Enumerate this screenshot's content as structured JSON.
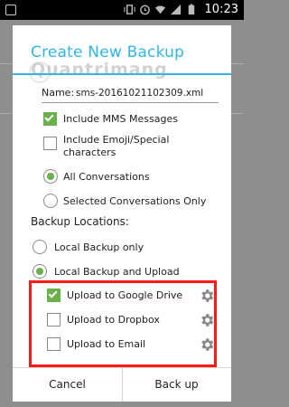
{
  "status": {
    "time": "10:23"
  },
  "dialog": {
    "title": "Create New Backup",
    "watermark": "Quantrimang",
    "name_label": "Name:",
    "name_value": "sms-20161021102309.xml",
    "options": {
      "include_mms": {
        "label": "Include MMS Messages",
        "checked": true
      },
      "include_emoji": {
        "label_line1": "Include Emoji/Special",
        "label_line2": "characters",
        "checked": false
      }
    },
    "conversations": {
      "all": {
        "label": "All Conversations",
        "selected": true
      },
      "selected_only": {
        "label": "Selected Conversations Only",
        "selected": false
      }
    },
    "backup_locations": {
      "heading": "Backup Locations:",
      "local_only": {
        "label": "Local Backup only",
        "selected": false
      },
      "local_upload": {
        "label": "Local Backup and Upload",
        "selected": true
      }
    },
    "uploads": [
      {
        "label": "Upload to Google Drive",
        "checked": true
      },
      {
        "label": "Upload to Dropbox",
        "checked": false
      },
      {
        "label": "Upload to Email",
        "checked": false
      }
    ],
    "buttons": {
      "cancel": "Cancel",
      "backup": "Back up"
    }
  },
  "colors": {
    "accent": "#33b5e5",
    "check": "#6ab04c",
    "highlight": "#ff1a1a"
  },
  "icons": [
    "gear-icon",
    "status-icons"
  ]
}
